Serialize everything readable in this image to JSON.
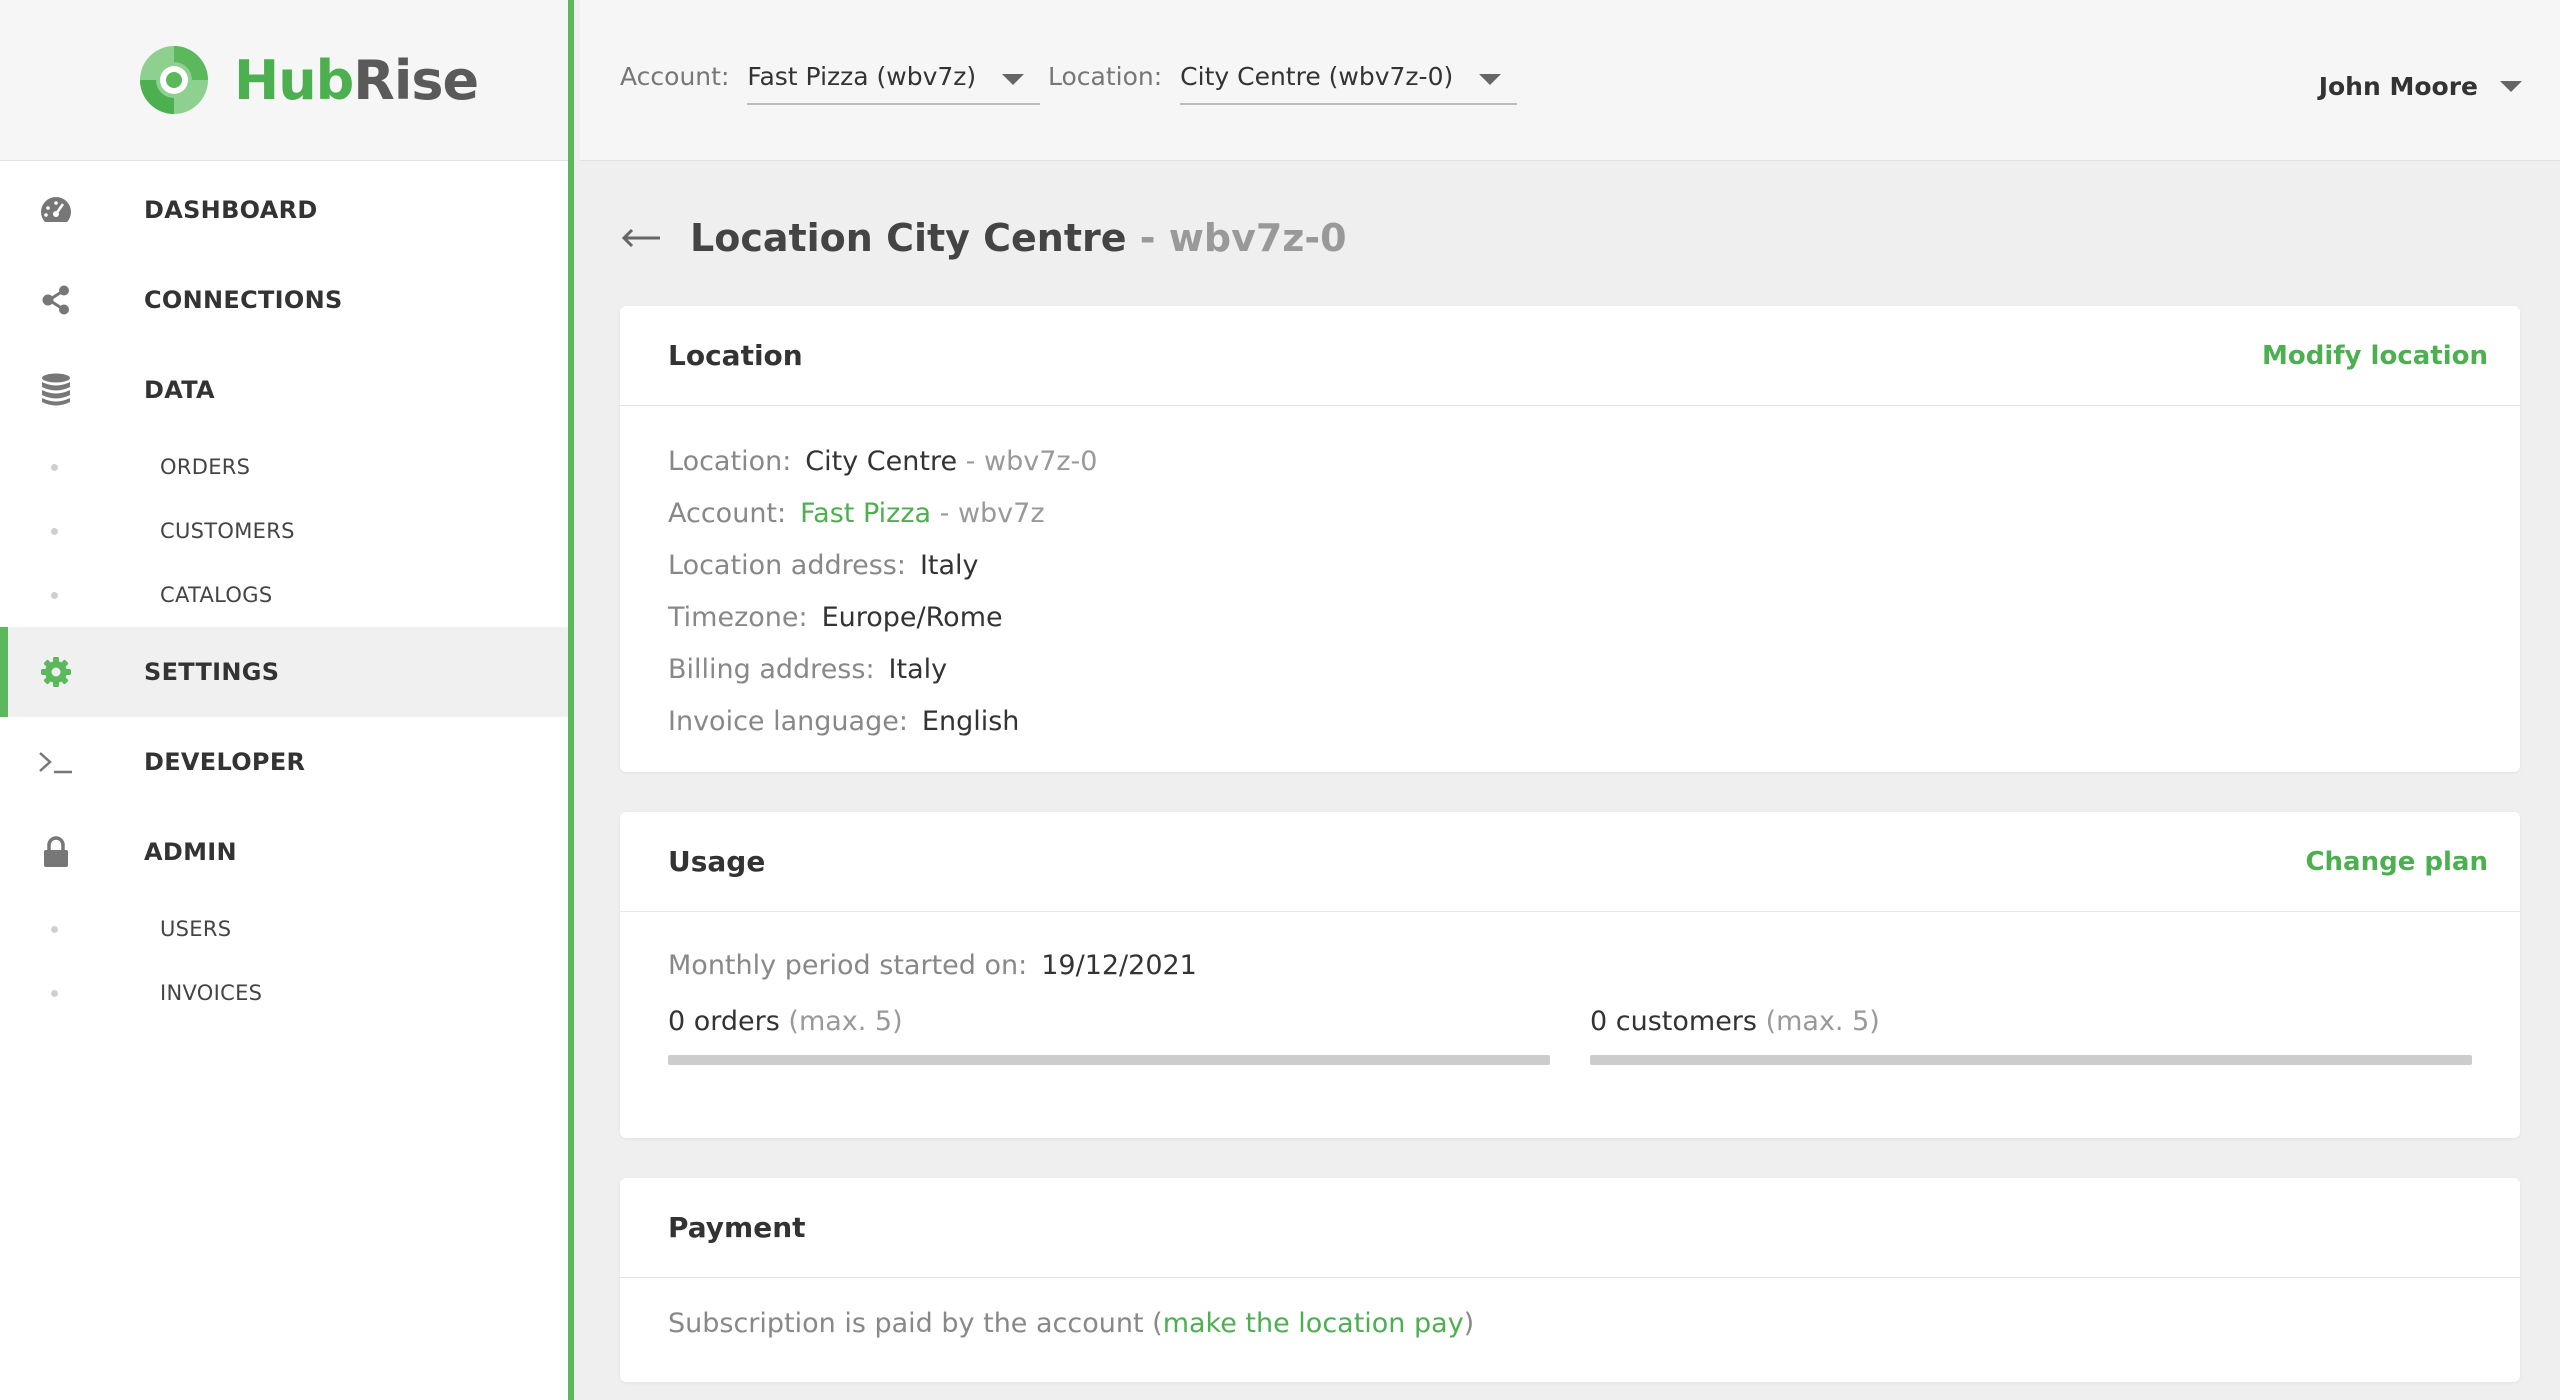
{
  "brand": {
    "name_part1": "Hub",
    "name_part2": "Rise",
    "accent": "#5cb85c"
  },
  "sidebar": {
    "items": [
      {
        "label": "DASHBOARD",
        "icon": "dashboard-gauge-icon"
      },
      {
        "label": "CONNECTIONS",
        "icon": "share-nodes-icon"
      },
      {
        "label": "DATA",
        "icon": "database-icon"
      },
      {
        "label": "ORDERS"
      },
      {
        "label": "CUSTOMERS"
      },
      {
        "label": "CATALOGS"
      },
      {
        "label": "SETTINGS",
        "icon": "gear-icon",
        "active": true
      },
      {
        "label": "DEVELOPER",
        "icon": "terminal-prompt-icon"
      },
      {
        "label": "ADMIN",
        "icon": "lock-icon"
      },
      {
        "label": "USERS"
      },
      {
        "label": "INVOICES"
      }
    ]
  },
  "topbar": {
    "account_label": "Account:",
    "account_value": "Fast Pizza (wbv7z)",
    "location_label": "Location:",
    "location_value": "City Centre (wbv7z-0)",
    "user_name": "John Moore"
  },
  "page": {
    "title_main": "Location City Centre",
    "title_suffix": " - wbv7z-0"
  },
  "location_card": {
    "title": "Location",
    "action": "Modify location",
    "location_key": "Location:",
    "location_value": "City Centre",
    "location_suffix": " - wbv7z-0",
    "account_key": "Account:",
    "account_link": "Fast Pizza",
    "account_suffix": " - wbv7z",
    "address_key": "Location address:",
    "address_value": "Italy",
    "timezone_key": "Timezone:",
    "timezone_value": "Europe/Rome",
    "billing_key": "Billing address:",
    "billing_value": "Italy",
    "language_key": "Invoice language:",
    "language_value": "English"
  },
  "usage_card": {
    "title": "Usage",
    "action": "Change plan",
    "period_key": "Monthly period started on:",
    "period_value": "19/12/2021",
    "orders_count": "0 orders",
    "orders_max": " (max. 5)",
    "orders_fraction": 0,
    "customers_count": "0 customers",
    "customers_max": " (max. 5)",
    "customers_fraction": 0
  },
  "payment_card": {
    "title": "Payment",
    "text_before": "Subscription is paid by the account (",
    "link": "make the location pay",
    "text_after": ")"
  }
}
